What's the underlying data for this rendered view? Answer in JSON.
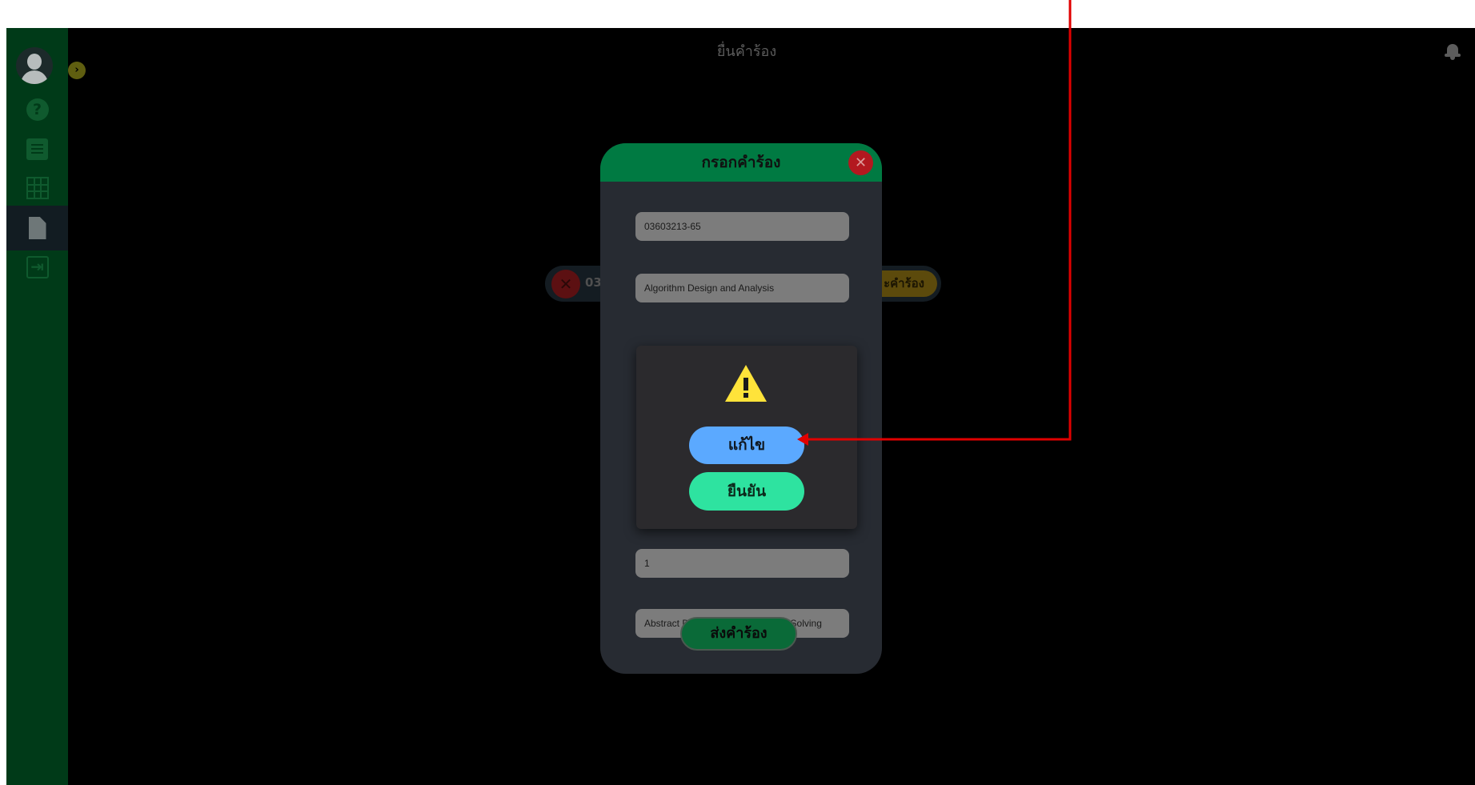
{
  "header": {
    "title": "ยื่นคำร้อง"
  },
  "sidebar": {
    "expand_icon": "chevron-right-icon",
    "items": [
      {
        "icon": "help-icon",
        "glyph": "?"
      },
      {
        "icon": "list-icon"
      },
      {
        "icon": "grid-icon"
      },
      {
        "icon": "document-icon"
      },
      {
        "icon": "logout-icon",
        "glyph": "⇥"
      }
    ]
  },
  "background_request": {
    "code_fragment": "03",
    "status_fragment": "ะคำร้อง"
  },
  "modal": {
    "title": "กรอกคำร้อง",
    "fields": {
      "course_code": "03603213-65",
      "course_name": "Algorithm Design and Analysis",
      "section": "1",
      "reason": "Abstract Data Types and Problem Solving"
    },
    "submit_label": "ส่งคำร้อง"
  },
  "confirm_dialog": {
    "icon": "warning-icon",
    "edit_label": "แก้ไข",
    "confirm_label": "ยืนยัน"
  },
  "colors": {
    "sidebar": "#003a18",
    "modal_header": "#007a42",
    "edit_button": "#5ba9ff",
    "confirm_button": "#2ee3a0",
    "annotation": "#e00000"
  }
}
